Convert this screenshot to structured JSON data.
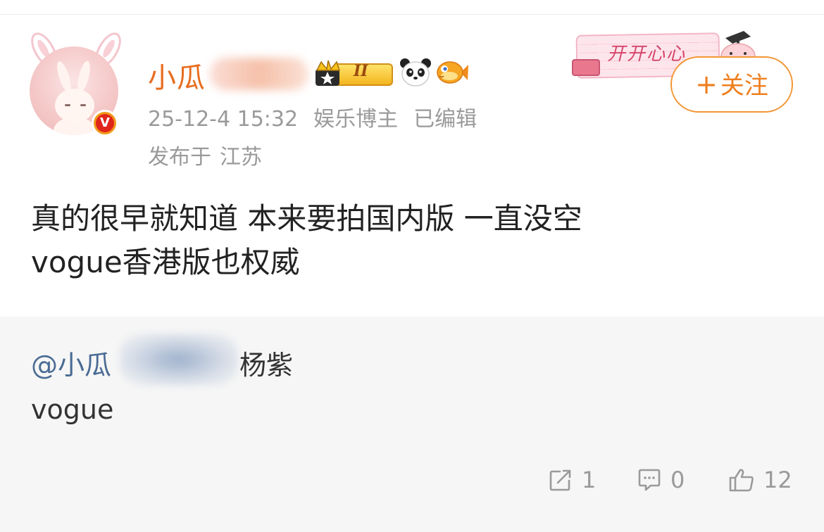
{
  "post": {
    "author": {
      "name_visible": "小瓜",
      "meta": {
        "time": "25-12-4 15:32",
        "role": "娱乐博主",
        "edited": "已编辑"
      },
      "location": {
        "prefix": "发布于",
        "place": "江苏"
      },
      "level_badge": "II",
      "verified_badge": "V"
    },
    "decoration": {
      "text": "开开心心"
    },
    "follow": {
      "plus": "+",
      "label": "关注"
    },
    "content": {
      "line1": "真的很早就知道 本来要拍国内版 一直没空",
      "line2": "vogue香港版也权威"
    },
    "quoted": {
      "author_prefix": "@小瓜",
      "author_tail": "杨紫",
      "text": "vogue"
    },
    "actions": {
      "repost_count": "1",
      "comment_count": "0",
      "like_count": "12"
    }
  },
  "colors": {
    "username": "#e86c20",
    "follow_accent": "#ee7f1e",
    "mention": "#4a6b94",
    "meta": "#9a9a9a",
    "quote_bg": "#f6f6f6"
  },
  "icons": {
    "avatar": "bunny-avatar",
    "verified": "verified-v-badge",
    "crown": "crown-icon",
    "panda": "panda-icon",
    "fish": "fish-icon",
    "repost": "repost-icon",
    "comment": "comment-icon",
    "like": "thumbs-up-icon"
  }
}
